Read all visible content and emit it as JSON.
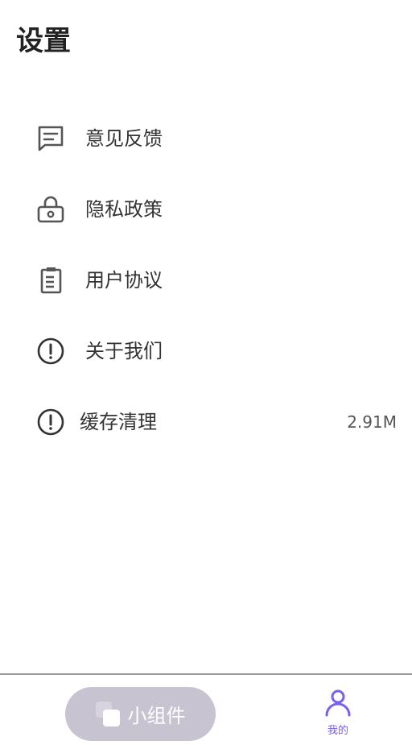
{
  "header": {
    "title": "设置"
  },
  "menu": {
    "items": [
      {
        "label": "意见反馈",
        "icon": "message-icon"
      },
      {
        "label": "隐私政策",
        "icon": "lock-icon"
      },
      {
        "label": "用户协议",
        "icon": "clipboard-icon"
      },
      {
        "label": "关于我们",
        "icon": "info-icon"
      },
      {
        "label": "缓存清理",
        "icon": "info-icon",
        "value": "2.91M"
      }
    ]
  },
  "tabbar": {
    "widget_label": "小组件",
    "mine_label": "我的",
    "active_color": "#7b5ef2",
    "pill_color": "#c7c3d0"
  }
}
